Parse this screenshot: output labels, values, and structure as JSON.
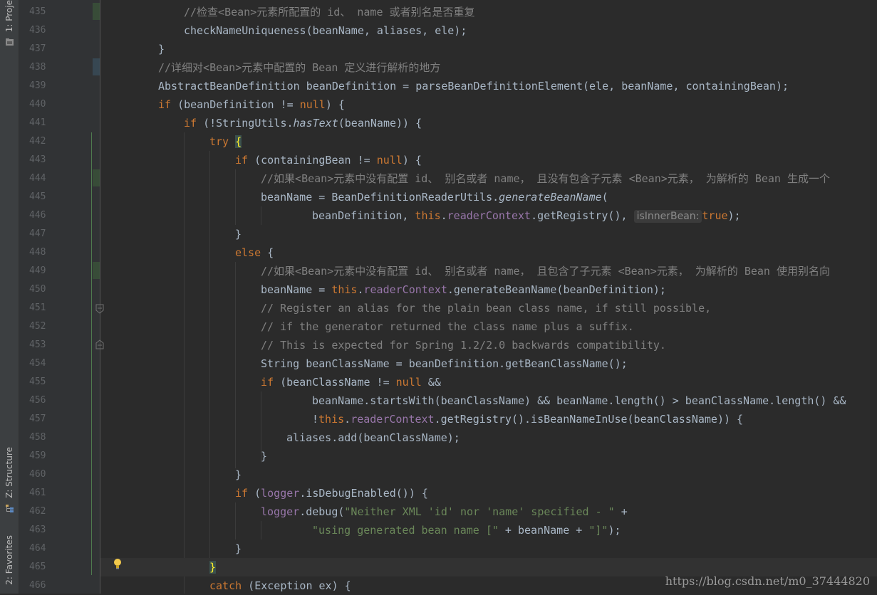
{
  "tool_windows": {
    "project": "1: Proje",
    "structure": "Z: Structure",
    "favorites": "2: Favorites"
  },
  "line_numbers": [
    "435",
    "436",
    "437",
    "438",
    "439",
    "440",
    "441",
    "442",
    "443",
    "444",
    "445",
    "446",
    "447",
    "448",
    "449",
    "450",
    "451",
    "452",
    "453",
    "454",
    "455",
    "456",
    "457",
    "458",
    "459",
    "460",
    "461",
    "462",
    "463",
    "464",
    "465",
    "466"
  ],
  "code": {
    "l435": "//检查<Bean>元素所配置的 id、 name 或者别名是否重复",
    "l436": "checkNameUniqueness(beanName, aliases, ele);",
    "l437": "}",
    "l438": "//详细对<Bean>元素中配置的 Bean 定义进行解析的地方",
    "l439": "AbstractBeanDefinition beanDefinition = parseBeanDefinitionElement(ele, beanName, containingBean);",
    "l440_kw": "if",
    "l440_a": " (beanDefinition != ",
    "l440_null": "null",
    "l440_b": ") {",
    "l441_kw": "if",
    "l441_a": " (!StringUtils.",
    "l441_m": "hasText",
    "l441_b": "(beanName)) {",
    "l442_kw": "try",
    "l442_brace": "{",
    "l443_kw": "if",
    "l443_a": " (containingBean != ",
    "l443_null": "null",
    "l443_b": ") {",
    "l444": "//如果<Bean>元素中没有配置 id、 别名或者 name， 且没有包含子元素 <Bean>元素， 为解析的 Bean 生成一个",
    "l445_a": "beanName = BeanDefinitionReaderUtils.",
    "l445_m": "generateBeanName",
    "l445_b": "(",
    "l446_a": "beanDefinition, ",
    "l446_this": "this",
    "l446_dot": ".",
    "l446_fld": "readerContext",
    "l446_b": ".getRegistry(), ",
    "l446_hint": "isInnerBean:",
    "l446_true": "true",
    "l446_c": ");",
    "l447": "}",
    "l448_kw": "else",
    "l448_b": " {",
    "l449": "//如果<Bean>元素中没有配置 id、 别名或者 name， 且包含了子元素 <Bean>元素， 为解析的 Bean 使用别名向",
    "l450_a": "beanName = ",
    "l450_this": "this",
    "l450_dot": ".",
    "l450_fld": "readerContext",
    "l450_b": ".generateBeanName(beanDefinition);",
    "l451": "// Register an alias for the plain bean class name, if still possible,",
    "l452": "// if the generator returned the class name plus a suffix.",
    "l453": "// This is expected for Spring 1.2/2.0 backwards compatibility.",
    "l454": "String beanClassName = beanDefinition.getBeanClassName();",
    "l455_kw": "if",
    "l455_a": " (beanClassName != ",
    "l455_null": "null",
    "l455_b": " &&",
    "l456": "beanName.startsWith(beanClassName) && beanName.length() > beanClassName.length() &&",
    "l457_a": "!",
    "l457_this": "this",
    "l457_dot": ".",
    "l457_fld": "readerContext",
    "l457_b": ".getRegistry().isBeanNameInUse(beanClassName)) {",
    "l458": "aliases.add(beanClassName);",
    "l459": "}",
    "l460": "}",
    "l461_kw": "if",
    "l461_a": " (",
    "l461_fld": "logger",
    "l461_b": ".isDebugEnabled()) {",
    "l462_fld": "logger",
    "l462_a": ".debug(",
    "l462_str": "\"Neither XML 'id' nor 'name' specified - \"",
    "l462_b": " +",
    "l463_str1": "\"using generated bean name [\"",
    "l463_a": " + beanName + ",
    "l463_str2": "\"]\"",
    "l463_b": ");",
    "l464": "}",
    "l465": "}",
    "l466_kw": "catch",
    "l466_a": " (Exception ex) {"
  },
  "watermark": "https://blog.csdn.net/m0_37444820",
  "colors": {
    "background": "#2b2b2b",
    "keyword": "#cc7832",
    "comment": "#808080",
    "string": "#6a8759",
    "field": "#9876aa",
    "text": "#a9b7c6",
    "line_number": "#606366"
  }
}
